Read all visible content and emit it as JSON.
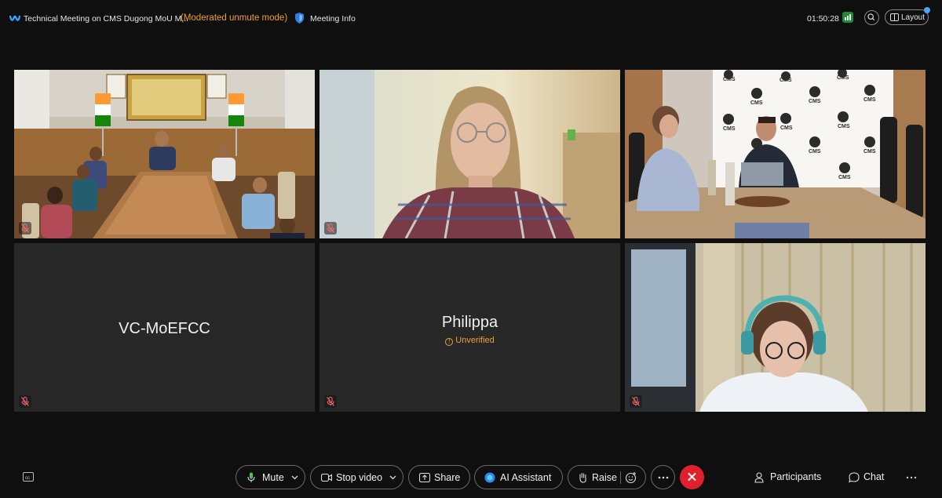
{
  "header": {
    "meeting_title": "Technical Meeting on CMS Dugong MoU M...",
    "mode": "(Moderated unmute mode)",
    "meeting_info": "Meeting Info",
    "timer": "01:50:28",
    "layout_label": "Layout"
  },
  "tiles": [
    {
      "id": "room-india",
      "type": "video",
      "muted": true
    },
    {
      "id": "participant-2",
      "type": "video",
      "muted": true
    },
    {
      "id": "room-cms",
      "type": "video",
      "muted": false
    },
    {
      "id": "vc-moefcc",
      "type": "name",
      "name": "VC-MoEFCC",
      "muted": true
    },
    {
      "id": "philippa",
      "type": "name",
      "name": "Philippa",
      "status": "Unverified",
      "muted": true
    },
    {
      "id": "participant-6",
      "type": "video",
      "muted": true
    }
  ],
  "scene_text": {
    "cms": "CMS"
  },
  "controls": {
    "mute": "Mute",
    "stop_video": "Stop video",
    "share": "Share",
    "ai_assistant": "AI Assistant",
    "raise": "Raise",
    "participants": "Participants",
    "chat": "Chat"
  },
  "colors": {
    "accent_orange": "#f0a12a",
    "end_call": "#e0202e",
    "background": "#0f0f0f",
    "tile": "#282828"
  },
  "icons": [
    "webex-logo-icon",
    "shield-icon",
    "signal-icon",
    "search-icon",
    "layout-icon",
    "mic-off-icon",
    "mic-icon",
    "video-icon",
    "share-icon",
    "ai-icon",
    "hand-icon",
    "reaction-icon",
    "more-icon",
    "end-call-icon",
    "participants-icon",
    "chat-icon",
    "captions-icon"
  ]
}
